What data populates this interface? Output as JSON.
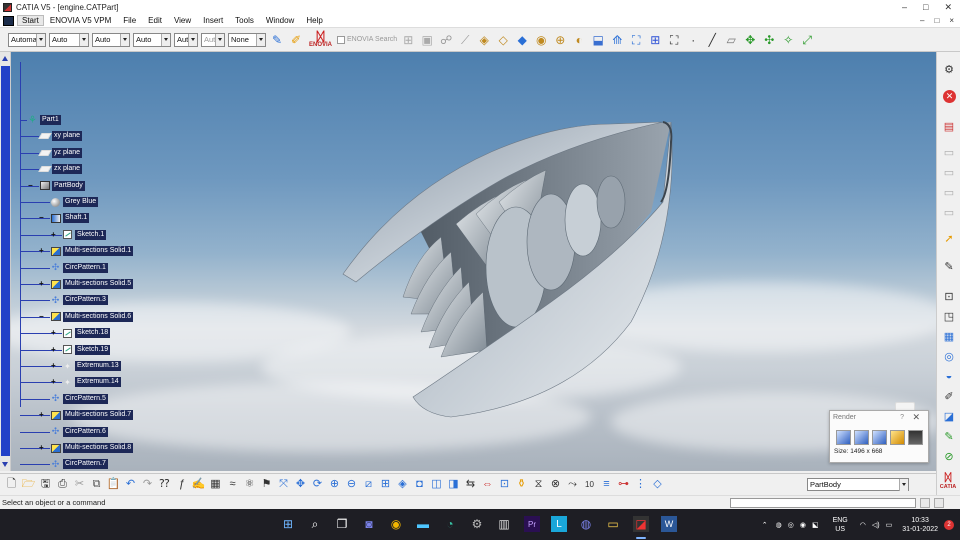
{
  "window": {
    "title": "CATIA V5 - [engine.CATPart]",
    "controls": [
      "–",
      "□",
      "✕"
    ],
    "mdi_controls": [
      "–",
      "□",
      "×"
    ]
  },
  "menu": {
    "items": [
      "Start",
      "ENOVIA V5 VPM",
      "File",
      "Edit",
      "View",
      "Insert",
      "Tools",
      "Window",
      "Help"
    ]
  },
  "toolbar_top": {
    "combos": [
      {
        "value": "Automa",
        "disabled": false
      },
      {
        "value": "Auto",
        "disabled": false
      },
      {
        "value": "Auto",
        "disabled": false
      },
      {
        "value": "Auto",
        "disabled": false
      },
      {
        "value": "Aut",
        "disabled": false
      },
      {
        "value": "Aut",
        "disabled": true
      },
      {
        "value": "None",
        "disabled": false
      }
    ],
    "enovia_logo": "ENOVIA",
    "enovia_search": "ENOVIA Search"
  },
  "tree": {
    "nodes": [
      {
        "label": "Part1",
        "icon": "part-icon",
        "level": 0,
        "expander": ""
      },
      {
        "label": "xy plane",
        "icon": "plane-icon",
        "level": 1,
        "expander": ""
      },
      {
        "label": "yz plane",
        "icon": "plane-icon",
        "level": 1,
        "expander": ""
      },
      {
        "label": "zx plane",
        "icon": "plane-icon",
        "level": 1,
        "expander": ""
      },
      {
        "label": "PartBody",
        "icon": "body-icon",
        "level": 1,
        "expander": "−"
      },
      {
        "label": "Grey Blue",
        "icon": "material-sphere-icon",
        "level": 2,
        "expander": ""
      },
      {
        "label": "Shaft.1",
        "icon": "shaft-icon",
        "level": 2,
        "expander": "−"
      },
      {
        "label": "Sketch.1",
        "icon": "sketch-icon",
        "level": 3,
        "expander": "+"
      },
      {
        "label": "Multi-sections Solid.1",
        "icon": "multi-section-solid-icon",
        "level": 2,
        "expander": "+"
      },
      {
        "label": "CircPattern.1",
        "icon": "circpattern-icon",
        "level": 2,
        "expander": ""
      },
      {
        "label": "Multi-sections Solid.5",
        "icon": "multi-section-solid-icon",
        "level": 2,
        "expander": "+"
      },
      {
        "label": "CircPattern.3",
        "icon": "circpattern-icon",
        "level": 2,
        "expander": ""
      },
      {
        "label": "Multi-sections Solid.6",
        "icon": "multi-section-solid-icon",
        "level": 2,
        "expander": "−"
      },
      {
        "label": "Sketch.18",
        "icon": "sketch-icon",
        "level": 3,
        "expander": "+"
      },
      {
        "label": "Sketch.19",
        "icon": "sketch-icon",
        "level": 3,
        "expander": "+"
      },
      {
        "label": "Extremum.13",
        "icon": "extremum-icon",
        "level": 3,
        "expander": "+"
      },
      {
        "label": "Extremum.14",
        "icon": "extremum-icon",
        "level": 3,
        "expander": "+"
      },
      {
        "label": "CircPattern.5",
        "icon": "circpattern-icon",
        "level": 2,
        "expander": ""
      },
      {
        "label": "Multi-sections Solid.7",
        "icon": "multi-section-solid-icon",
        "level": 2,
        "expander": "+"
      },
      {
        "label": "CircPattern.6",
        "icon": "circpattern-icon",
        "level": 2,
        "expander": ""
      },
      {
        "label": "Multi-sections Solid.8",
        "icon": "multi-section-solid-icon",
        "level": 2,
        "expander": "+"
      },
      {
        "label": "CircPattern.7",
        "icon": "circpattern-icon",
        "level": 2,
        "expander": ""
      }
    ]
  },
  "render_dialog": {
    "title": "Render",
    "help": "?",
    "close": "✕",
    "size_text": "Size: 1496 x 668"
  },
  "bottom_toolbar": {
    "current_body": "PartBody"
  },
  "status": {
    "message": "Select an object or a command"
  },
  "taskbar": {
    "lang_line1": "ENG",
    "lang_line2": "US",
    "time": "10:33",
    "date": "31-01-2022",
    "notification_count": "2"
  },
  "colors": {
    "tree_highlight": "#1d2857",
    "tree_connector": "#2a3fb0",
    "scrollbar_thumb": "#2240c8",
    "sky_top": "#4d7fae",
    "taskbar_bg": "#1e1e24"
  }
}
